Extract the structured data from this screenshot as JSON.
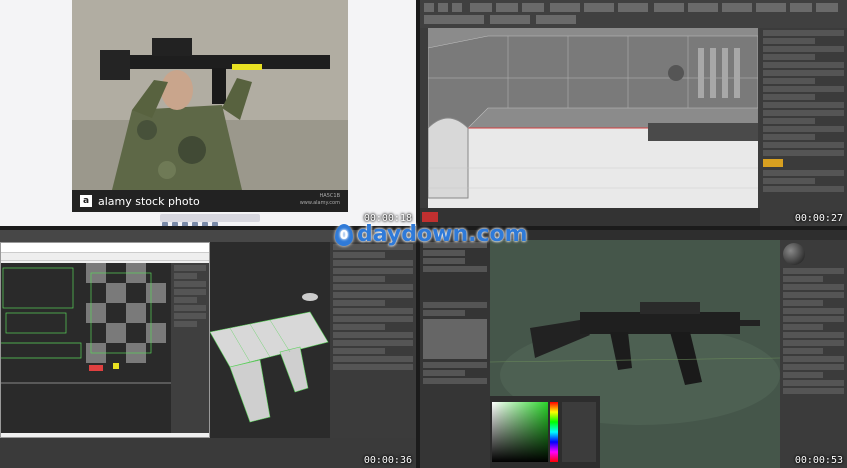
{
  "panels": [
    {
      "id": "stock-photo",
      "caption": "alamy stock photo",
      "logo_letter": "a",
      "image_id": "HA5C1B",
      "site": "www.alamy.com",
      "timestamp": "00:00:18"
    },
    {
      "id": "3dsmax-viewport",
      "timestamp": "00:00:27"
    },
    {
      "id": "uv-editor",
      "timestamp": "00:00:36"
    },
    {
      "id": "render-view",
      "timestamp": "00:00:53"
    }
  ],
  "watermark": {
    "icon_letter": "0",
    "text": "daydown.com"
  },
  "colors": {
    "watermark_blue": "#2f7ad8",
    "uv_green": "#5bd35b",
    "render_bg": "#3a4a3e"
  }
}
